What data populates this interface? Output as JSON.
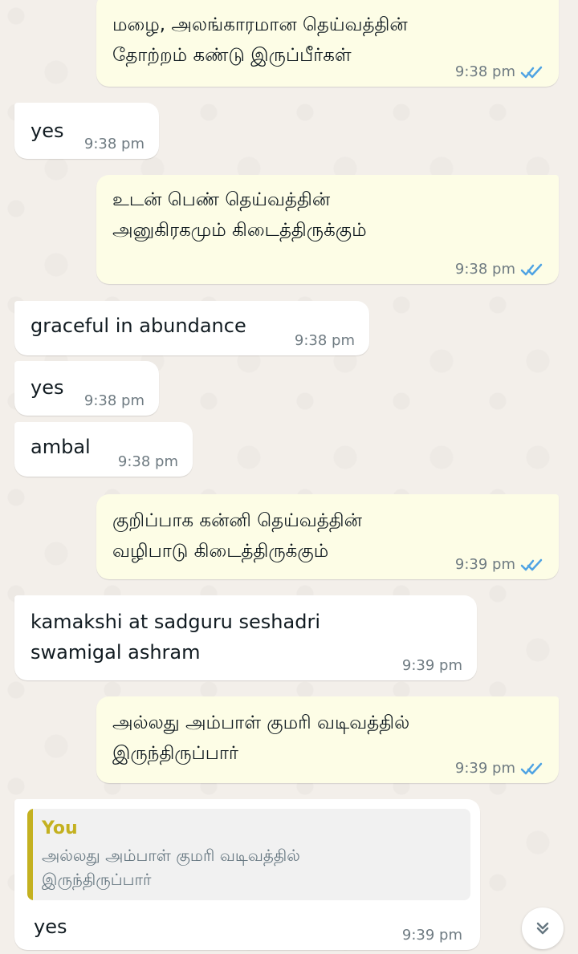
{
  "messages": [
    {
      "kind": "sent",
      "text_lines": [
        "மழை, அலங்காரமான தெய்வத்தின்",
        "தோற்றம் கண்டு இருப்பீர்கள்"
      ],
      "time": "9:38 pm",
      "status_icon": "double-check-icon"
    },
    {
      "kind": "received",
      "text_lines": [
        "yes"
      ],
      "time": "9:38 pm"
    },
    {
      "kind": "sent",
      "text_lines": [
        "உடன் பெண் தெய்வத்தின்",
        "அனுகிரகமும் கிடைத்திருக்கும்"
      ],
      "time": "9:38 pm",
      "status_icon": "double-check-icon"
    },
    {
      "kind": "received",
      "text_lines": [
        "graceful in abundance"
      ],
      "time": "9:38 pm"
    },
    {
      "kind": "received",
      "text_lines": [
        "yes"
      ],
      "time": "9:38 pm"
    },
    {
      "kind": "received",
      "text_lines": [
        "ambal"
      ],
      "time": "9:38 pm"
    },
    {
      "kind": "sent",
      "text_lines": [
        "குறிப்பாக கன்னி தெய்வத்தின்",
        "வழிபாடு கிடைத்திருக்கும்"
      ],
      "time": "9:39 pm",
      "status_icon": "double-check-icon"
    },
    {
      "kind": "received",
      "text_lines": [
        "kamakshi at sadguru seshadri",
        "swamigal ashram"
      ],
      "time": "9:39 pm"
    },
    {
      "kind": "sent",
      "text_lines": [
        "அல்லது அம்பாள் குமரி வடிவத்தில்",
        "இருந்திருப்பார்"
      ],
      "time": "9:39 pm",
      "status_icon": "double-check-icon"
    },
    {
      "kind": "received",
      "reply_to": {
        "author": "You",
        "text_lines": [
          "அல்லது அம்பாள் குமரி வடிவத்தில்",
          "இருந்திருப்பார்"
        ]
      },
      "text_lines": [
        "yes"
      ],
      "time": "9:39 pm"
    }
  ],
  "scroll_button": {
    "icon": "double-chevron-down-icon"
  },
  "colors": {
    "background": "#f3efea",
    "sent_bubble": "#fdfde6",
    "received_bubble": "#ffffff",
    "read_ticks": "#4fa3e3",
    "reply_accent": "#c4b120",
    "timestamp": "#6f7b82"
  }
}
